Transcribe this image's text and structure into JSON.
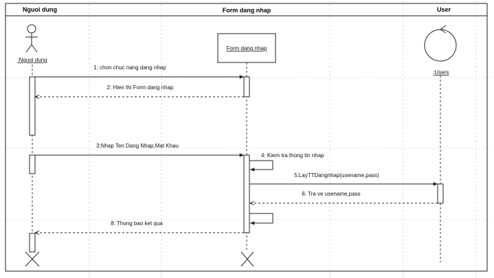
{
  "lanes": {
    "user_lane": "Nguoi dung",
    "form_lane": "Form dang nhap",
    "system_lane": "User"
  },
  "objects": {
    "actor_label": ":Nguoi dung",
    "form_box_label": "Form dang nhap",
    "entity_label": ":Users"
  },
  "messages": [
    {
      "id": 1,
      "label": "1: chon chuc nang dang nhap",
      "type": "call"
    },
    {
      "id": 2,
      "label": "2: Hien thi Form dang nhap",
      "type": "return"
    },
    {
      "id": 3,
      "label": "3:Nhap Ten Dang Nhap,Mat Khau",
      "type": "call"
    },
    {
      "id": 4,
      "label": "4: Kiem tra thong tin nhap",
      "type": "self"
    },
    {
      "id": 5,
      "label": "5:LayTTDangnhap(usename,pass)",
      "type": "call"
    },
    {
      "id": 6,
      "label": "6: Tra ve usename,pass",
      "type": "return"
    },
    {
      "id": 7,
      "label": "",
      "type": "self"
    },
    {
      "id": 8,
      "label": "8: Thong bao ket qua",
      "type": "return"
    }
  ]
}
